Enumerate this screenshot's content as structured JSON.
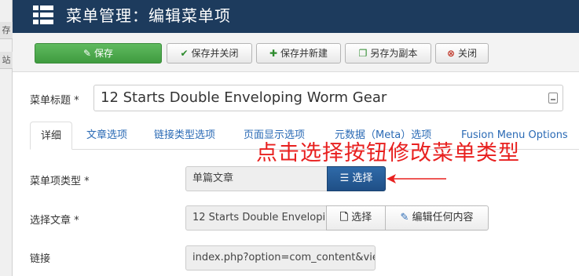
{
  "stub": {
    "cell1": "存",
    "cell2": "站"
  },
  "header": {
    "title": "菜单管理：编辑菜单项"
  },
  "toolbar": {
    "save": "保存",
    "save_close": "保存并关闭",
    "save_new": "保存并新建",
    "save_copy": "另存为副本",
    "close": "关闭"
  },
  "form": {
    "title_label": "菜单标题 *",
    "title_value": "12 Starts Double Enveloping Worm Gear",
    "tabs": [
      "详细",
      "文章选项",
      "链接类型选项",
      "页面显示选项",
      "元数据（Meta）选项",
      "Fusion Menu Options"
    ],
    "menu_type_label": "菜单项类型 *",
    "menu_type_value": "单篇文章",
    "select_button": "选择",
    "article_label": "选择文章 *",
    "article_value": "12 Starts Double Envelopi",
    "article_select": "选择",
    "article_edit": "编辑任何内容",
    "link_label": "链接",
    "link_value": "index.php?option=com_content&vie"
  },
  "annotation": {
    "text": "点击选择按钮修改菜单类型",
    "color": "#e8201f"
  },
  "colors": {
    "header_bg": "#1d3b5d",
    "save_green": "#4aa84a",
    "primary_blue": "#27609e",
    "link_blue": "#2a6ab5"
  }
}
